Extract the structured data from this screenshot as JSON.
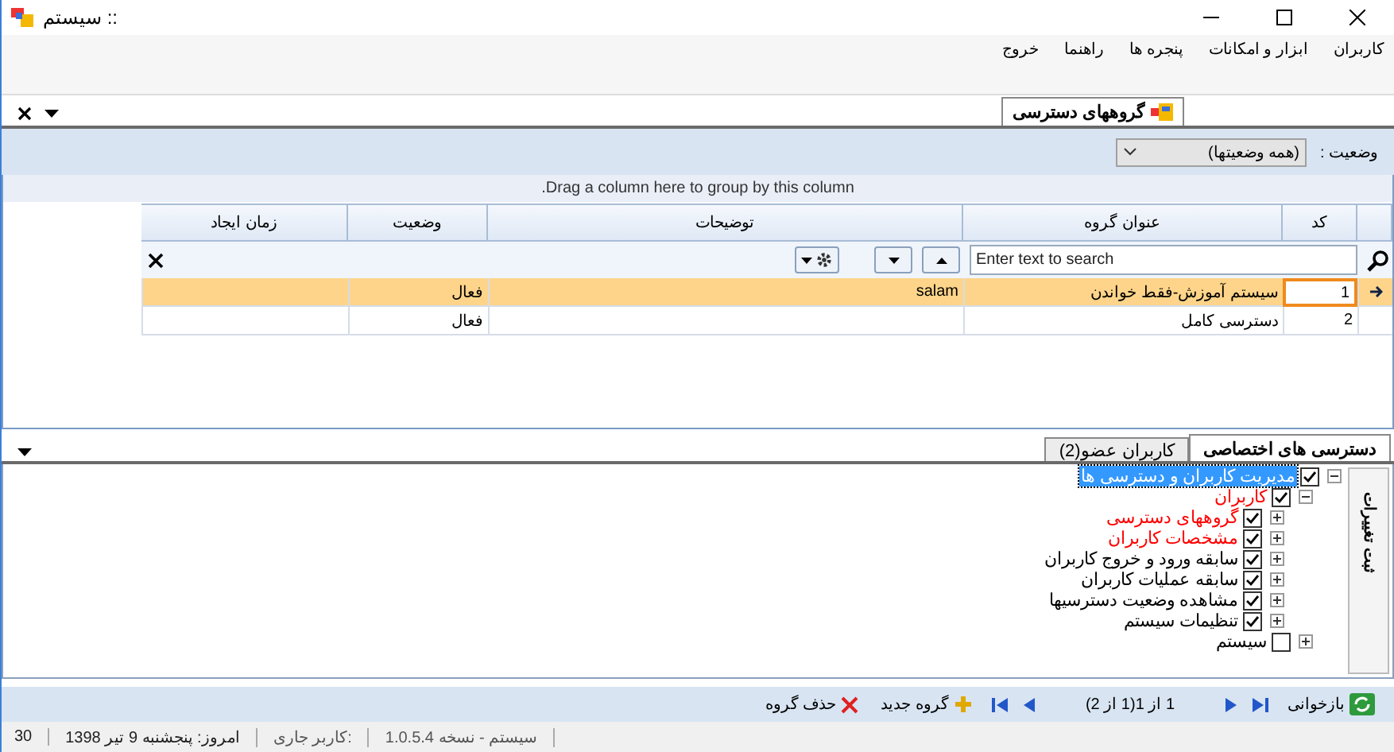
{
  "window": {
    "title": ":: سیستم"
  },
  "menu": [
    "کاربران",
    "ابزار و امکانات",
    "پنجره ها",
    "راهنما",
    "خروج"
  ],
  "document_tabs": [
    {
      "label": "گروههای دسترسی",
      "selected": true
    }
  ],
  "filter": {
    "label": "وضعیت :",
    "value": "(همه وضعیتها)"
  },
  "grid": {
    "group_panel": "Drag a column here to group by this column.",
    "columns": [
      "کد",
      "عنوان گروه",
      "توضیحات",
      "وضعیت",
      "زمان ایجاد"
    ],
    "search": {
      "placeholder": "Enter text to search"
    },
    "rows": [
      {
        "code": "1",
        "title": "سیستم آموزش-فقط خواندن",
        "description": "salam",
        "status": "فعال",
        "selected": true
      },
      {
        "code": "2",
        "title": "دسترسی کامل",
        "status": "فعال",
        "selected": false
      }
    ]
  },
  "detail_tabs": [
    {
      "label": "دسترسی های اختصاصی",
      "selected": true
    },
    {
      "label": "کاربران عضو(2)",
      "selected": false
    }
  ],
  "tree": [
    {
      "label": "مدیریت کاربران و دسترسی ها",
      "checked": true,
      "expanded": true,
      "selected": true,
      "children": [
        {
          "label": "کاربران",
          "checked": true,
          "expanded": true,
          "selected": false,
          "color": "#ff0000",
          "children": [
            {
              "label": "گروههای دسترسی",
              "checked": true,
              "expanded": false,
              "selected": false,
              "color": "#ff0000"
            },
            {
              "label": "مشخصات کاربران",
              "checked": true,
              "expanded": false,
              "selected": false,
              "color": "#ff0000"
            },
            {
              "label": "سابقه ورود و خروج کاربران",
              "checked": true,
              "expanded": false,
              "selected": false,
              "color": "#000000"
            },
            {
              "label": "سابقه عملیات کاربران",
              "checked": true,
              "expanded": false,
              "selected": false,
              "color": "#000000"
            },
            {
              "label": "مشاهده وضعیت دسترسیها",
              "checked": true,
              "expanded": false,
              "selected": false,
              "color": "#000000"
            },
            {
              "label": "تنظیمات سیستم",
              "checked": true,
              "expanded": false,
              "selected": false,
              "color": "#000000"
            }
          ]
        },
        {
          "label": "سیستم",
          "checked": false,
          "expanded": false,
          "selected": false,
          "color": "#000000"
        }
      ]
    }
  ],
  "side_button": "ثبت تغییرات",
  "navigator": {
    "refresh": "بازخوانی",
    "page": "1 از 1(1 از 2)",
    "add": "گروه جدید",
    "delete": "حذف گروه"
  },
  "status_bar": [
    "سیستم - نسخه 1.0.5.4",
    "کاربر جاری:",
    "امروز: پنجشنبه 9 تیر 1398",
    "30"
  ]
}
